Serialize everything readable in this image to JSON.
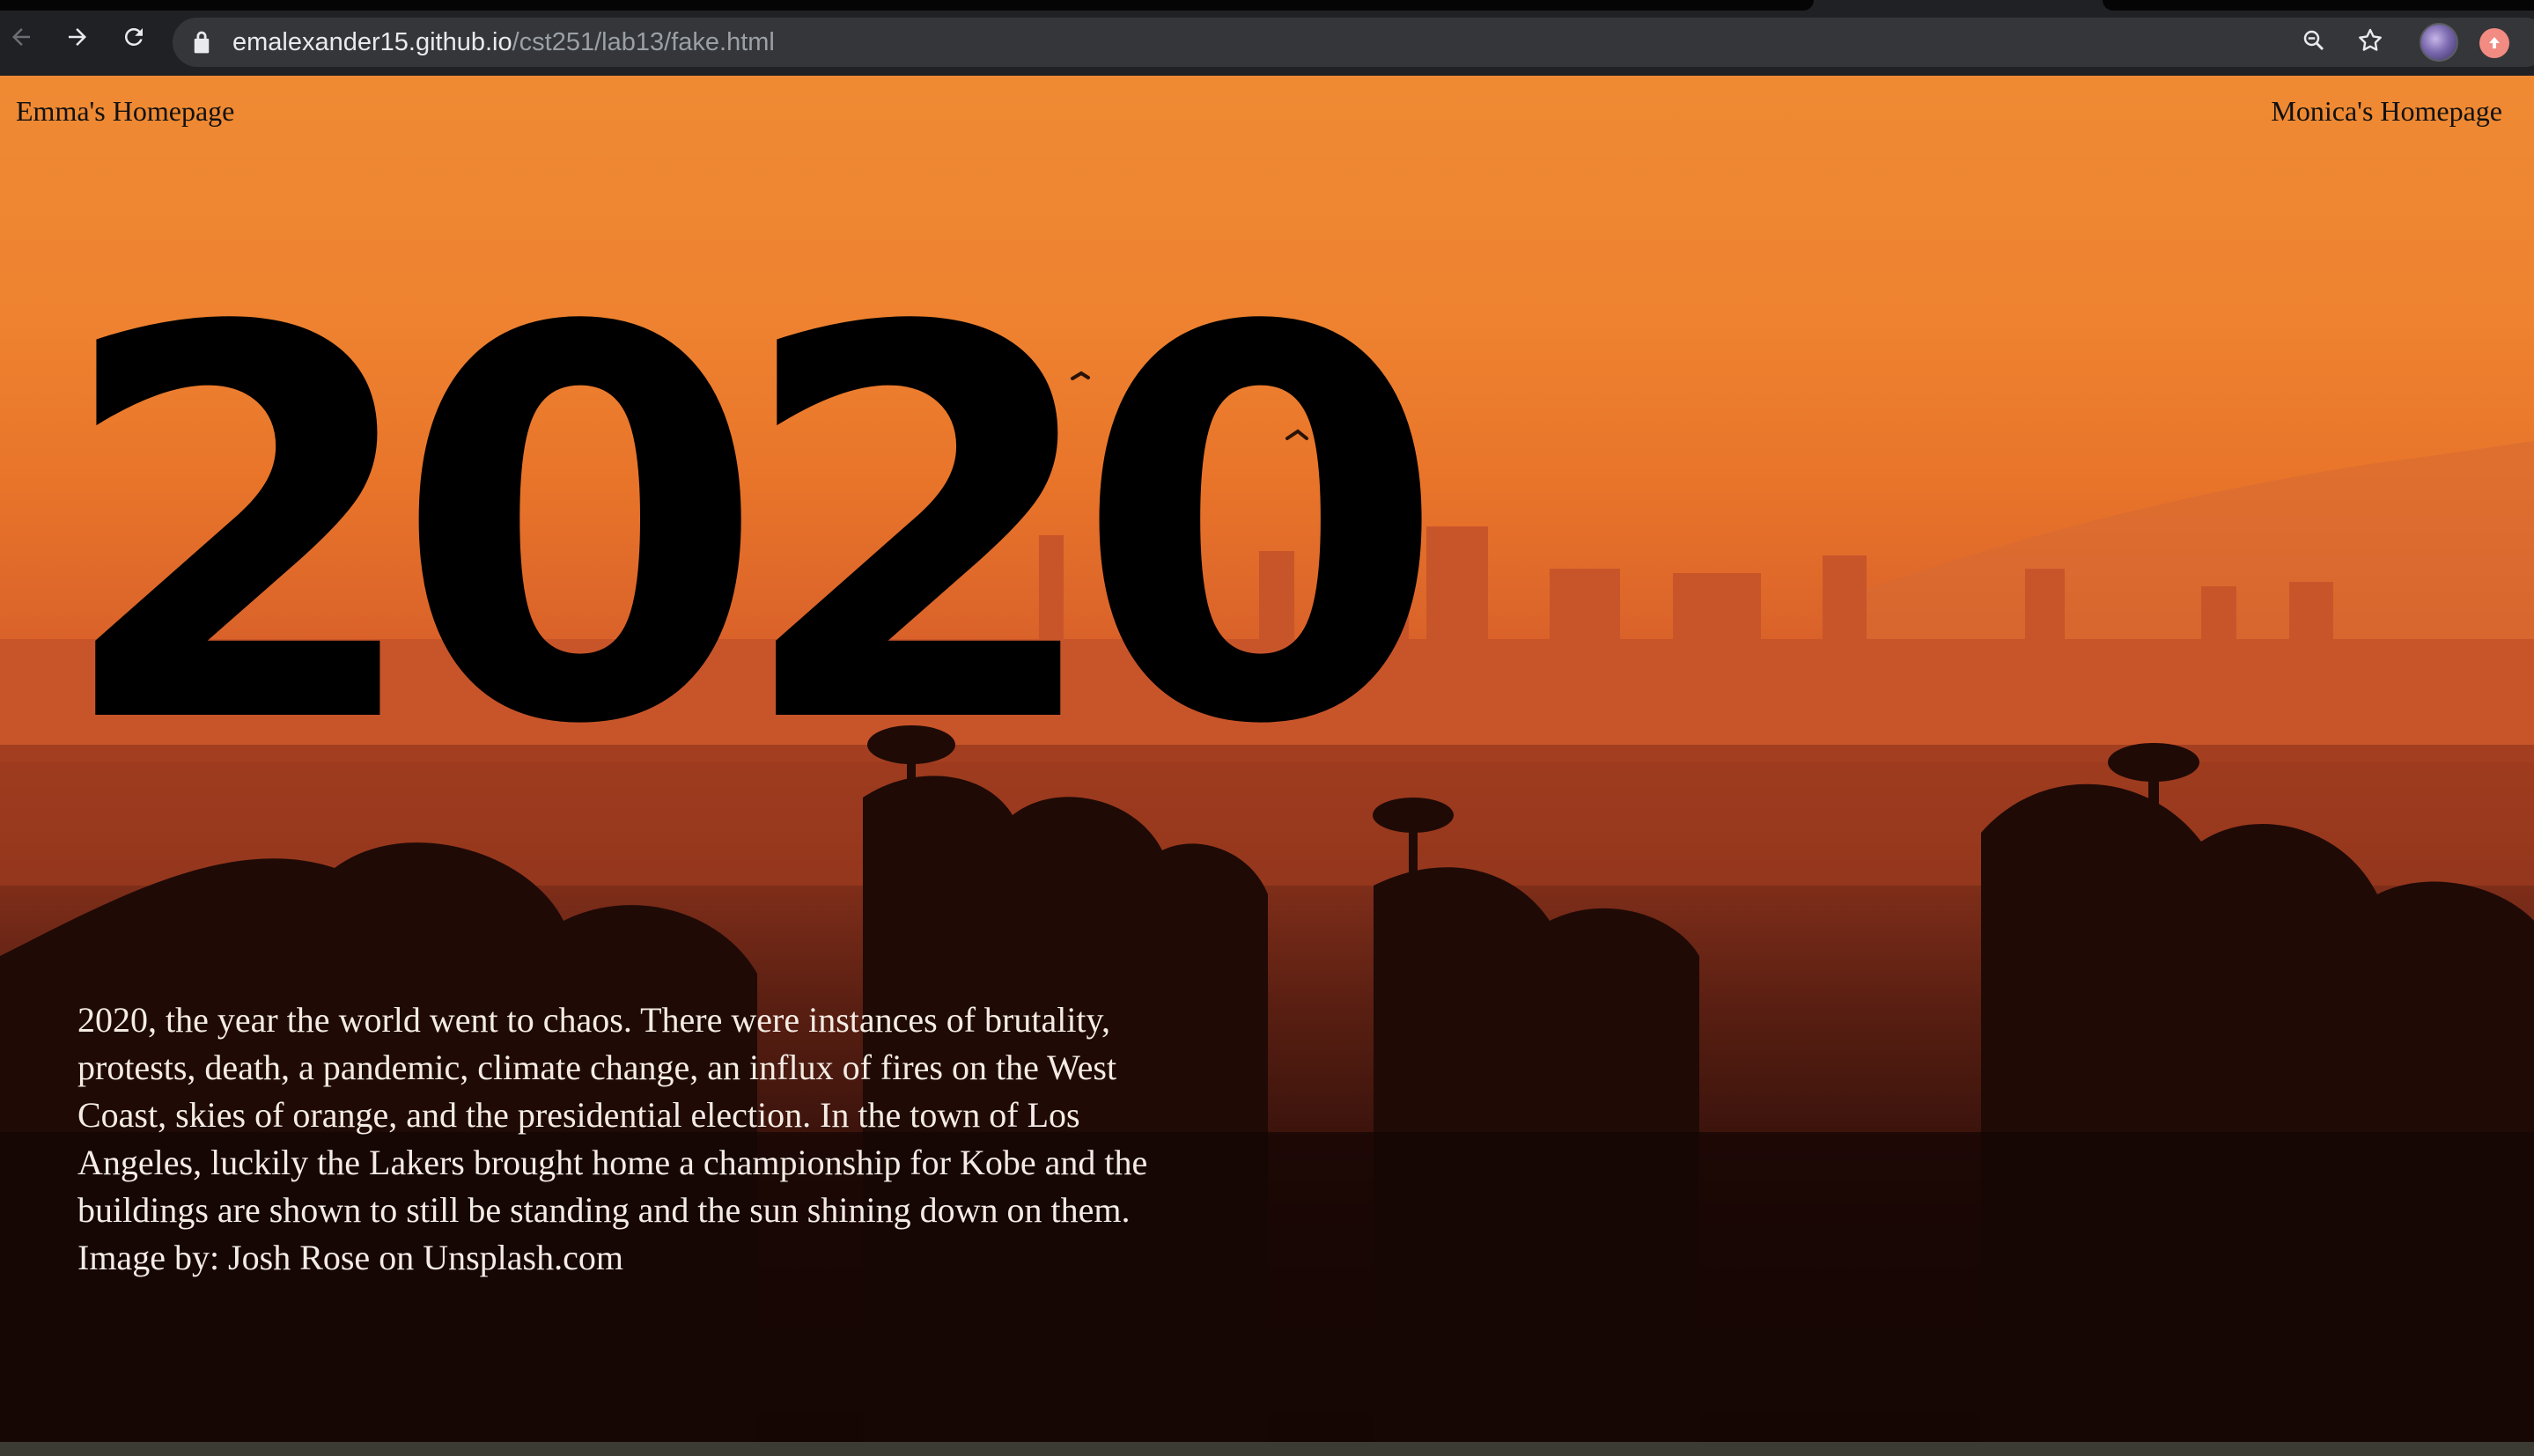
{
  "browser": {
    "url_host": "emalexander15.github.io",
    "url_path": "/cst251/lab13/fake.html",
    "icons": [
      "back-icon",
      "forward-icon",
      "reload-icon",
      "lock-icon",
      "zoom-icon",
      "bookmark-star-icon",
      "profile-avatar",
      "extension-icon"
    ]
  },
  "page": {
    "nav_left": "Emma's Homepage",
    "nav_right": "Monica's Homepage",
    "headline": "2020",
    "caption_lines": [
      "2020, the year the world went to chaos. There were instances of brutality,",
      "protests, death, a pandemic, climate change, an influx of fires on the West",
      "Coast, skies of orange, and the presidential election. In the town of Los",
      "Angeles, luckily the Lakers brought home a championship for Kobe and the",
      "buildings are shown to still be standing and the sun shining down on them.",
      "Image by: Josh Rose on Unsplash.com"
    ]
  },
  "colors": {
    "chrome_bg": "#202124",
    "omnibox_bg": "#35363a",
    "sky_top": "#ef8a33",
    "sky_mid": "#d9612a",
    "ground_dark": "#1a0805",
    "headline_color": "#000000",
    "caption_color": "#f4ece4"
  }
}
